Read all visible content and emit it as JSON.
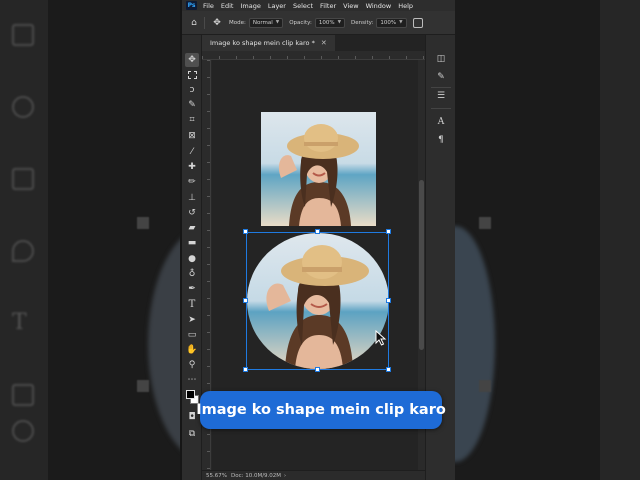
{
  "menubar": {
    "app_logo": "Ps",
    "items": [
      "File",
      "Edit",
      "Image",
      "Layer",
      "Select",
      "Filter",
      "View",
      "Window",
      "Help"
    ]
  },
  "options_bar": {
    "mode_label": "Mode:",
    "mode_value": "Normal",
    "opacity_label": "Opacity:",
    "opacity_value": "100%",
    "density_label": "Density:",
    "density_value": "100%"
  },
  "document_tab": {
    "title": "Image ko shape mein clip karo *",
    "close_glyph": "✕"
  },
  "status_bar": {
    "zoom": "55.67%",
    "doc_info": "Doc: 10.0M/9.02M"
  },
  "caption": {
    "text": "Image ko shape mein clip karo",
    "color": "#1e6bd6"
  },
  "colors": {
    "ui_background": "#282828",
    "canvas": "#242424",
    "selection": "#1f7ae0",
    "foreground_swatch": "#000000",
    "background_swatch": "#ffffff"
  },
  "icons": {
    "toolbar": [
      "move-icon",
      "marquee-icon",
      "lasso-icon",
      "magic-wand-icon",
      "crop-icon",
      "frame-icon",
      "eyedropper-icon",
      "healing-brush-icon",
      "brush-icon",
      "clone-stamp-icon",
      "history-brush-icon",
      "eraser-icon",
      "gradient-icon",
      "blur-icon",
      "dodge-icon",
      "pen-icon",
      "type-icon",
      "path-selection-icon",
      "rectangle-icon",
      "hand-icon",
      "zoom-icon",
      "more-tools-icon"
    ],
    "panels": [
      "layers-icon",
      "brush-settings-icon",
      "adjustments-icon",
      "character-icon",
      "paragraph-icon"
    ]
  }
}
